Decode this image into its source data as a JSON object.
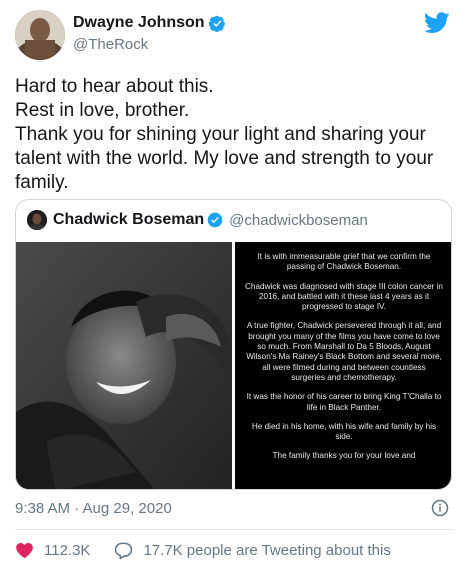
{
  "author": {
    "display_name": "Dwayne Johnson",
    "handle": "@TheRock"
  },
  "tweet_text": [
    "Hard to hear about this.",
    "Rest in love, brother.",
    "Thank you for shining your light and sharing your talent with the world. My love and strength to your family."
  ],
  "quote": {
    "display_name": "Chadwick Boseman",
    "handle": "@chadwickboseman",
    "statement": [
      "It is with immeasurable grief that we confirm the passing of Chadwick Boseman.",
      "Chadwick was diagnosed with stage III colon cancer in 2016, and battled with it these last 4 years as it progressed to stage IV.",
      "A true fighter, Chadwick persevered through it all, and brought you many of the films you have come to love so much. From Marshall to Da 5 Bloods, August Wilson's Ma Rainey's Black Bottom and several more, all were filmed during and between countless surgeries and chemotherapy.",
      "It was the honor of his career to bring King T'Challa to life in Black Panther.",
      "He died in his home, with his wife and family by his side.",
      "The family thanks you for your love and"
    ]
  },
  "timestamp": "9:38 AM · Aug 29, 2020",
  "actions": {
    "like_count": "112.3K",
    "reply_text": "17.7K people are Tweeting about this"
  },
  "colors": {
    "brand": "#1da1f2",
    "like": "#e0245e",
    "muted": "#657786"
  }
}
